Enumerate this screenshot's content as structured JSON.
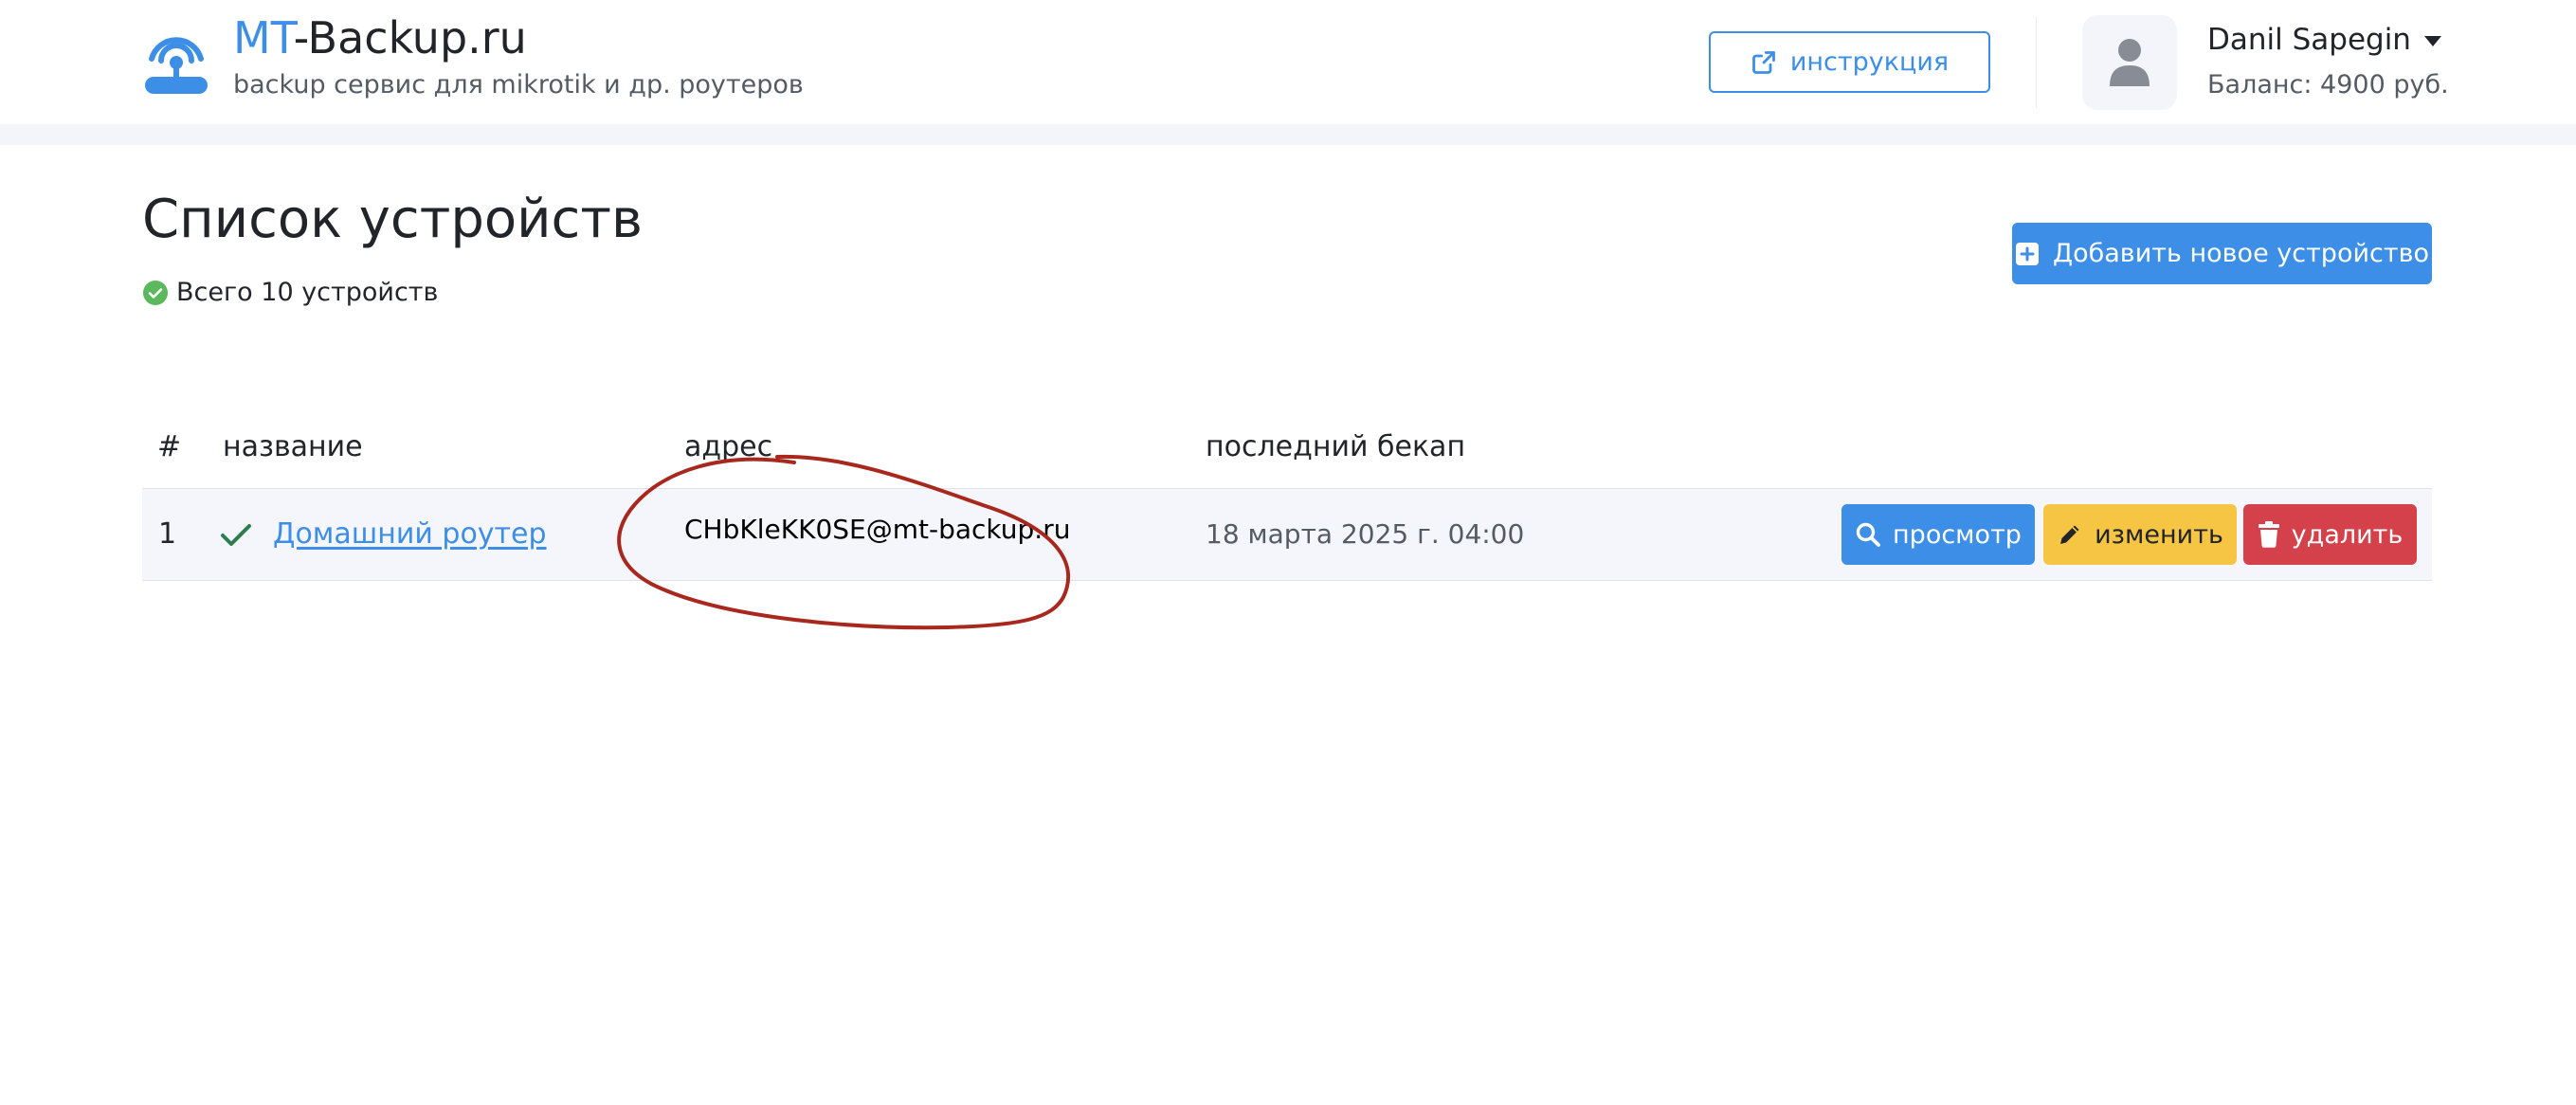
{
  "header": {
    "brand_accent": "MT",
    "brand_rest": "-Backup.ru",
    "subtitle": "backup сервис для mikrotik и др. роутеров",
    "instruction_label": "инструкция",
    "user_name": "Danil Sapegin",
    "balance": "Баланс: 4900 руб."
  },
  "page": {
    "title": "Список устройств",
    "device_count": "Всего 10 устройств",
    "add_button_label": "Добавить новое устройство"
  },
  "table": {
    "headers": {
      "num": "#",
      "name": "название",
      "address": "адрес",
      "last_backup": "последний бекап"
    },
    "rows": [
      {
        "num": "1",
        "name": "Домашний роутер",
        "address": "CHbKleKK0SE@mt-backup.ru",
        "last_backup": "18 марта 2025 г. 04:00",
        "status": "ok"
      }
    ],
    "actions": {
      "view": "просмотр",
      "edit": "изменить",
      "delete": "удалить"
    }
  },
  "colors": {
    "primary": "#3c8ee6",
    "warning": "#f7c544",
    "danger": "#d5414a",
    "success": "#5cb85c",
    "annotation": "#a8281e"
  },
  "icons": {
    "logo": "router-antenna-icon",
    "instruction": "external-link-icon",
    "avatar": "user-icon",
    "count_status": "check-circle-icon",
    "add": "plus-square-icon",
    "row_status": "check-icon",
    "view": "search-icon",
    "edit": "pencil-icon",
    "delete": "trash-icon"
  }
}
